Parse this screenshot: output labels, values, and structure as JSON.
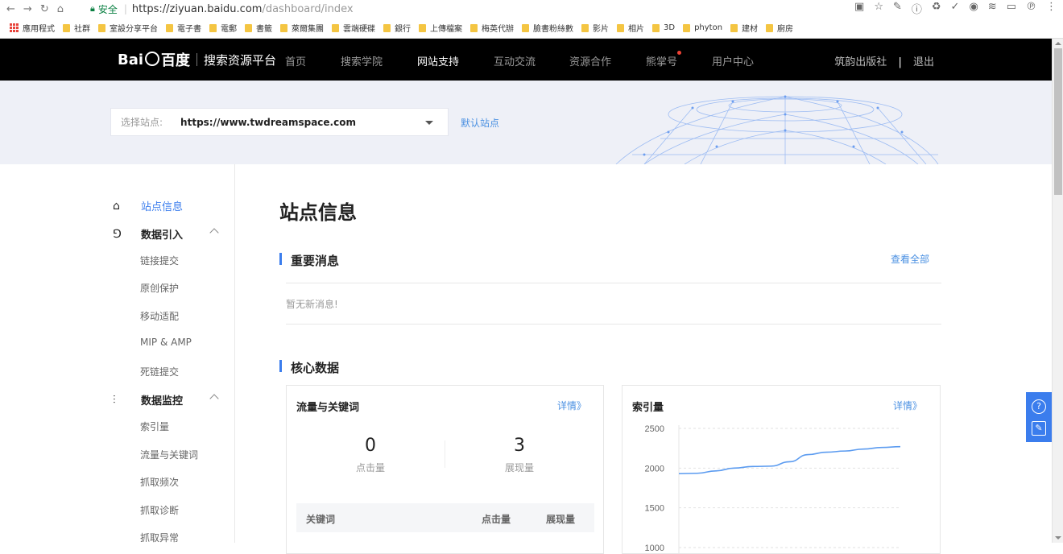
{
  "browser": {
    "secure_label": "安全",
    "url_host": "https://ziyuan.baidu.com",
    "url_path": "/dashboard/index",
    "bookmarks": [
      "應用程式",
      "社群",
      "室設分享平台",
      "電子書",
      "電郵",
      "書籤",
      "萊爾集團",
      "雲端硬碟",
      "銀行",
      "上傳檔案",
      "梅英代辦",
      "臉書粉絲數",
      "影片",
      "相片",
      "3D",
      "phyton",
      "建材",
      "廚房"
    ]
  },
  "topnav": {
    "logo_text": "Bai",
    "logo_cn": "百度",
    "platform": "搜索资源平台",
    "items": [
      "首页",
      "搜索学院",
      "网站支持",
      "互动交流",
      "资源合作",
      "熊掌号",
      "用户中心"
    ],
    "account": "筑韵出版社",
    "divider": "|",
    "logout": "退出"
  },
  "sitebar": {
    "select_label": "选择站点:",
    "select_value": "https://www.twdreamspace.com",
    "default_link": "默认站点"
  },
  "sidebar": {
    "g1": "站点信息",
    "g2": "数据引入",
    "g2_items": [
      "链接提交",
      "原创保护",
      "移动适配",
      "MIP & AMP",
      "死链提交"
    ],
    "g3": "数据监控",
    "g3_items": [
      "索引量",
      "流量与关键词",
      "抓取频次",
      "抓取诊断",
      "抓取异常"
    ]
  },
  "main": {
    "title": "站点信息",
    "news_head": "重要消息",
    "view_all": "查看全部",
    "no_news": "暂无新消息!",
    "core_head": "核心数据",
    "traffic": {
      "title": "流量与关键词",
      "detail": "详情》",
      "clicks": "0",
      "clicks_label": "点击量",
      "impressions": "3",
      "impressions_label": "展现量",
      "cols": [
        "关键词",
        "点击量",
        "展现量"
      ]
    },
    "index": {
      "title": "索引量",
      "detail": "详情》"
    }
  },
  "chart_data": {
    "type": "line",
    "title": "索引量",
    "y_ticks": [
      2500,
      2000,
      1500,
      1000
    ],
    "ylim": [
      1000,
      2500
    ],
    "series": [
      {
        "values": [
          1930,
          1935,
          1965,
          2000,
          2020,
          2025,
          2080,
          2170,
          2200,
          2215,
          2240,
          2260,
          2270
        ]
      }
    ],
    "color": "#5b9bf0",
    "grid": true
  }
}
